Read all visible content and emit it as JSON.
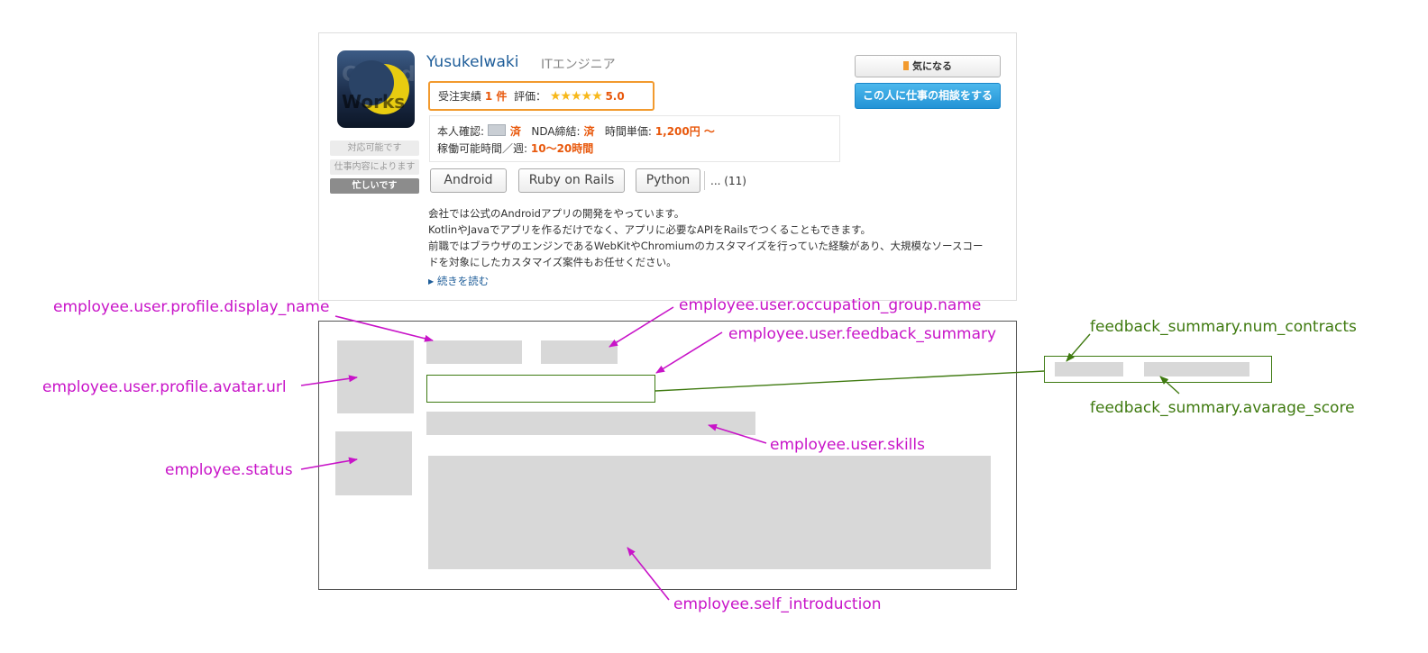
{
  "profile_card": {
    "display_name": "YusukeIwaki",
    "occupation": "ITエンジニア",
    "avatar_text": [
      "Crowd",
      "Works"
    ],
    "feedback": {
      "contracts_label": "受注実績",
      "contracts_value": "1 件",
      "rating_label": "評価：",
      "stars": "★★★★★",
      "score": "5.0"
    },
    "verification": {
      "identity_label": "本人確認:",
      "identity_value": "済",
      "nda_label": "NDA締結:",
      "nda_value": "済",
      "hourly_label": "時間単価:",
      "hourly_value": "1,200円 〜",
      "hours_label": "稼働可能時間／週:",
      "hours_value": "10〜20時間"
    },
    "status_options": [
      "対応可能です",
      "仕事内容によります",
      "忙しいです"
    ],
    "skills": [
      "Android",
      "Ruby on Rails",
      "Python"
    ],
    "skills_more": "... (11)",
    "bookmark_button": "気になる",
    "consult_button": "この人に仕事の相談をする",
    "self_introduction": [
      "会社では公式のAndroidアプリの開発をやっています。",
      "KotlinやJavaでアプリを作るだけでなく、アプリに必要なAPIをRailsでつくることもできます。",
      "前職ではブラウザのエンジンであるWebKitやChromiumのカスタマイズを行っていた経験があり、大規模なソースコー",
      "ドを対象にしたカスタマイズ案件もお任せください。"
    ],
    "read_more": "続きを読む"
  },
  "annotations": {
    "display_name": "employee.user.profile.display_name",
    "occupation_group": "employee.user.occupation_group.name",
    "feedback_summary": "employee.user.feedback_summary",
    "avatar_url": "employee.user.profile.avatar.url",
    "skills": "employee.user.skills",
    "status": "employee.status",
    "self_introduction": "employee.self_introduction",
    "num_contracts": "feedback_summary.num_contracts",
    "avarage_score": "feedback_summary.avarage_score"
  },
  "colors": {
    "magenta_label": "#c814c8",
    "green_label": "#3f7a10",
    "placeholder": "#d8d8d8",
    "accent_orange": "#e8580c",
    "link_blue": "#1e5d99",
    "cta_blue": "#2393d6"
  },
  "icons": [
    "bookmark-flag-icon",
    "identity-card-icon",
    "star-icon",
    "crescent-moon-logo",
    "triangle-right-icon"
  ]
}
